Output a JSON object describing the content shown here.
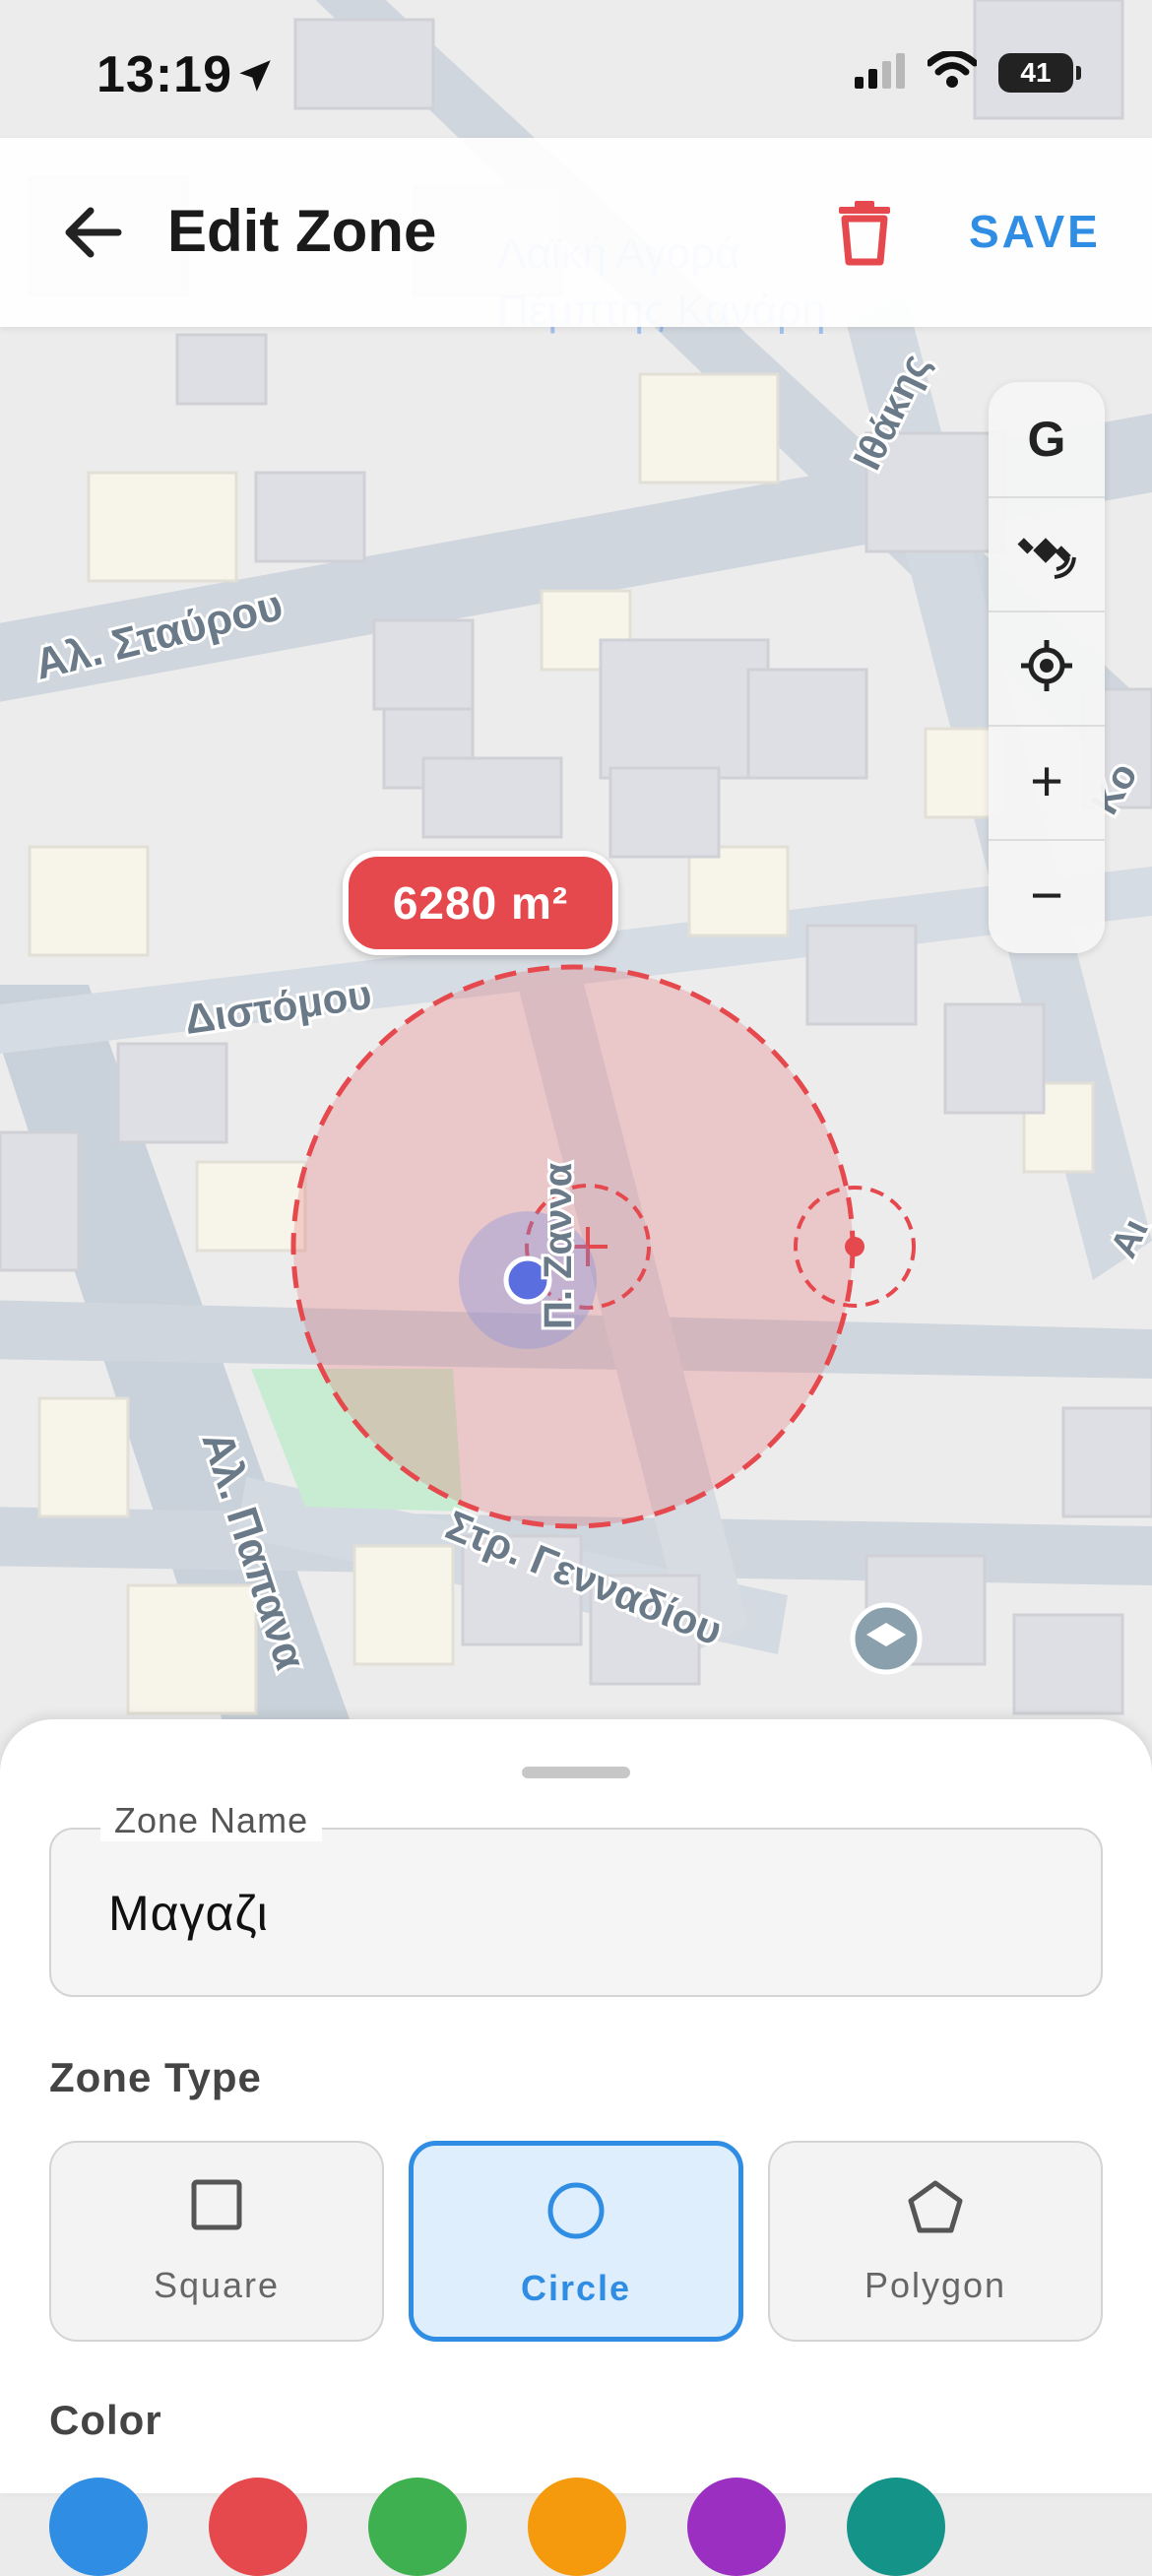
{
  "status": {
    "time": "13:19",
    "battery": "41"
  },
  "app_bar": {
    "title": "Edit Zone",
    "save_label": "SAVE"
  },
  "map": {
    "streets": [
      "Αλ. Σταύρου",
      "Διστόμου",
      "Αλ. Παπανα",
      "Στρ. Γενναδίου",
      "Ιθάκης",
      "Π. Ζαννα",
      "Κο",
      "Αι"
    ],
    "poi": [
      "Λαϊκή Αγορά",
      "Πέμπτης Κανάρη"
    ],
    "controls": [
      "G",
      "satellite-icon",
      "locate-icon",
      "+",
      "−"
    ]
  },
  "zone": {
    "area": "6280 m²",
    "shape": "circle",
    "color": "#e5484d"
  },
  "sheet": {
    "name_label": "Zone Name",
    "name_value": "Μαγαζι",
    "type_label": "Zone Type",
    "types": [
      {
        "label": "Square",
        "icon": "square-icon",
        "selected": false
      },
      {
        "label": "Circle",
        "icon": "circle-icon",
        "selected": true
      },
      {
        "label": "Polygon",
        "icon": "pentagon-icon",
        "selected": false
      }
    ],
    "color_label": "Color",
    "colors": [
      "#2f8de4",
      "#e5484d",
      "#3fb04f",
      "#f59a0c",
      "#9b2fc2",
      "#149488"
    ]
  }
}
